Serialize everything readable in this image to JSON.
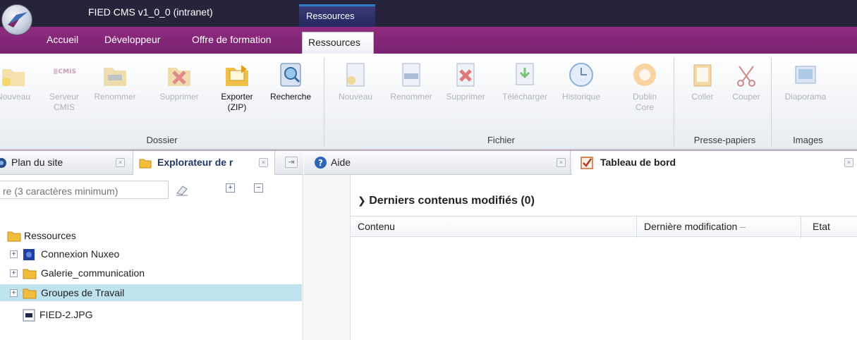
{
  "app": {
    "window_title": "FIED CMS v1_0_0 (intranet)",
    "context_label": "Ressources"
  },
  "tabs": [
    "Accueil",
    "Développeur",
    "Offre de formation",
    "Ressources"
  ],
  "active_tab": "Ressources",
  "ribbon": {
    "groups": [
      {
        "label": "Dossier",
        "buttons": [
          {
            "label": "Nouveau",
            "icon": "new-folder-icon",
            "enabled": false
          },
          {
            "label": "Serveur CMIS",
            "icon": "cmis-server-icon",
            "enabled": false
          },
          {
            "label": "Renommer",
            "icon": "rename-icon",
            "enabled": false
          },
          {
            "label": "Supprimer",
            "icon": "delete-icon",
            "enabled": false
          },
          {
            "label": "Exporter (ZIP)",
            "icon": "export-zip-icon",
            "enabled": true
          },
          {
            "label": "Recherche",
            "icon": "search-icon",
            "enabled": true
          }
        ]
      },
      {
        "label": "Fichier",
        "buttons": [
          {
            "label": "Nouveau",
            "icon": "new-file-icon",
            "enabled": false
          },
          {
            "label": "Renommer",
            "icon": "rename-icon",
            "enabled": false
          },
          {
            "label": "Supprimer",
            "icon": "delete-icon",
            "enabled": false
          },
          {
            "label": "Télécharger",
            "icon": "download-icon",
            "enabled": false
          },
          {
            "label": "Historique",
            "icon": "history-icon",
            "enabled": false
          },
          {
            "label": "Dublin Core",
            "icon": "dublin-core-icon",
            "enabled": false
          }
        ]
      },
      {
        "label": "Presse-papiers",
        "buttons": [
          {
            "label": "Coller",
            "icon": "paste-icon",
            "enabled": false
          },
          {
            "label": "Couper",
            "icon": "cut-icon",
            "enabled": false
          }
        ]
      },
      {
        "label": "Images",
        "buttons": [
          {
            "label": "Diaporama",
            "icon": "slideshow-icon",
            "enabled": false
          }
        ]
      }
    ]
  },
  "left_panel": {
    "tabs": [
      {
        "label": "Plan du site",
        "icon": "sitemap-icon"
      },
      {
        "label": "Explorateur de r",
        "icon": "folder-icon",
        "active": true
      }
    ],
    "search_placeholder": "re (3 caractères minimum)",
    "tree": [
      {
        "label": "Ressources",
        "icon": "folder-icon",
        "expander": false,
        "selected": false
      },
      {
        "label": "Connexion Nuxeo",
        "icon": "nuxeo-icon",
        "expander": true,
        "selected": false
      },
      {
        "label": "Galerie_communication",
        "icon": "folder-icon",
        "expander": true,
        "selected": false
      },
      {
        "label": "Groupes de Travail",
        "icon": "folder-icon",
        "expander": true,
        "selected": true
      },
      {
        "label": "FIED-2.JPG",
        "icon": "image-file-icon",
        "expander": false,
        "selected": false
      }
    ]
  },
  "right_panel": {
    "tabs": [
      {
        "label": "Aide",
        "icon": "help-icon"
      },
      {
        "label": "Tableau de bord",
        "icon": "checkbox-icon",
        "active": true
      }
    ],
    "dashboard": {
      "section_title": "Derniers contenus modifiés (0)",
      "columns": [
        "Contenu",
        "Dernière modification",
        "Etat"
      ],
      "sort_indicator": "–"
    }
  },
  "colors": {
    "titlebar": "#26243a",
    "tabsbar": "#8e2c80",
    "selection": "#bfe3ef"
  }
}
